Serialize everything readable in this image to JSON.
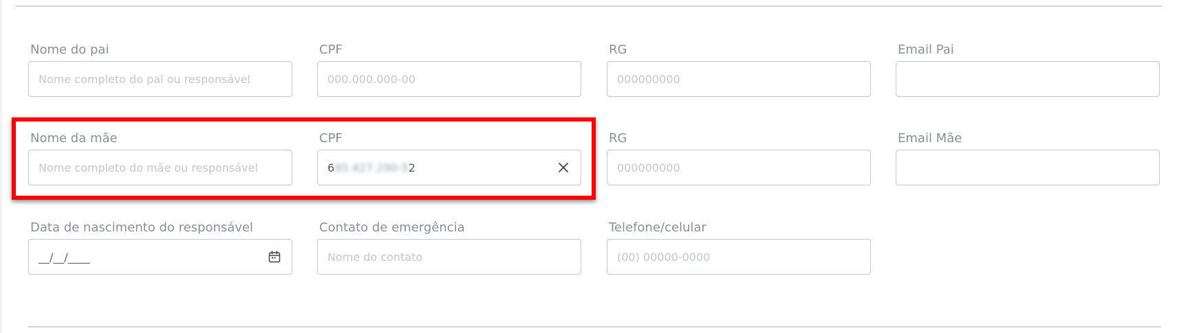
{
  "fields": {
    "nome_pai": {
      "label": "Nome do pai",
      "placeholder": "Nome completo do pai ou responsável"
    },
    "cpf_pai": {
      "label": "CPF",
      "placeholder": "000.000.000-00"
    },
    "rg_pai": {
      "label": "RG",
      "placeholder": "000000000"
    },
    "email_pai": {
      "label": "Email Pai",
      "placeholder": ""
    },
    "nome_mae": {
      "label": "Nome da mãe",
      "placeholder": "Nome completo do mãe ou responsável"
    },
    "cpf_mae": {
      "label": "CPF",
      "value_first": "6",
      "value_blurred": "85.427.290-5",
      "value_last": "2"
    },
    "rg_mae": {
      "label": "RG",
      "placeholder": "000000000"
    },
    "email_mae": {
      "label": "Email Mãe",
      "placeholder": ""
    },
    "data_nascimento": {
      "label": "Data de nascimento do responsável",
      "placeholder": "__/__/____"
    },
    "contato_emergencia": {
      "label": "Contato de emergência",
      "placeholder": "Nome do contato"
    },
    "telefone": {
      "label": "Telefone/celular",
      "placeholder": "(00) 00000-0000"
    }
  },
  "colors": {
    "label": "#8a9099",
    "placeholder": "#c3c7cd",
    "border": "#c6cad0",
    "highlight": "#ff0000"
  },
  "icons": {
    "clear": "close-icon",
    "date": "calendar-icon"
  }
}
